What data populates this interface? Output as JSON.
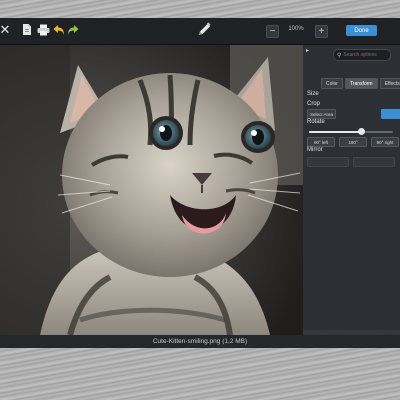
{
  "toolbar": {
    "close_icon": "close-icon",
    "zoom_out_label": "−",
    "zoom_value": "100%",
    "zoom_in_label": "+",
    "done_label": "Done",
    "icons": [
      "document-icon",
      "print-icon",
      "undo-icon",
      "redo-icon",
      "pencil-icon"
    ]
  },
  "panel": {
    "expand_icon": "▸",
    "search_placeholder": "Search options",
    "tabs": [
      {
        "label": "Color"
      },
      {
        "label": "Transform"
      },
      {
        "label": "Effects"
      }
    ],
    "size_label": "Size",
    "crop_label": "Crop",
    "select_area_label": "Select Area",
    "rotate_label": "Rotate",
    "rotate_slider_value": 0.62,
    "rotate_left_label": "90° left",
    "rotate_180_label": "180°",
    "rotate_right_label": "90° right",
    "mirror_label": "Mirror"
  },
  "status": {
    "file_label": "Cute-Kitten-smiling.png (1,2 MB)"
  },
  "colors": {
    "accent": "#3b8fd4",
    "toolbar_bg": "#1f2124",
    "panel_bg": "#2d3034"
  }
}
